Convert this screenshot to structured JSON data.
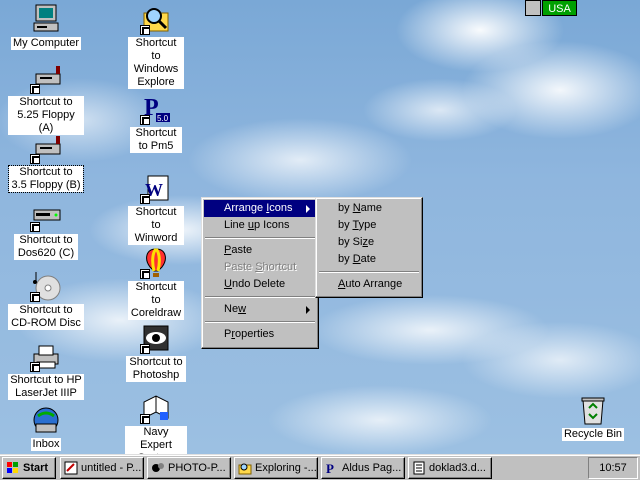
{
  "desktop": {
    "icons": [
      {
        "label": "My Computer"
      },
      {
        "label": "Shortcut to 5.25 Floppy (A)"
      },
      {
        "label": "Shortcut to 3.5 Floppy (B)"
      },
      {
        "label": "Shortcut to Dos620 (C)"
      },
      {
        "label": "Shortcut to CD-ROM Disc"
      },
      {
        "label": "Shortcut to HP LaserJet IIIP"
      },
      {
        "label": "Inbox"
      },
      {
        "label": "Shortcut to Windows Explore"
      },
      {
        "label": "Shortcut to Pm5"
      },
      {
        "label": "Shortcut to Winword"
      },
      {
        "label": "Shortcut to Coreldraw"
      },
      {
        "label": "Shortcut to Photoshp"
      },
      {
        "label": "Navy Expert System"
      },
      {
        "label": "Recycle Bin"
      }
    ]
  },
  "context_menu": {
    "items": [
      {
        "label": "Arrange Icons",
        "mnemonic": "I"
      },
      {
        "label": "Line up Icons",
        "mnemonic": "u"
      },
      {
        "label": "Paste",
        "mnemonic": "P"
      },
      {
        "label": "Paste Shortcut",
        "mnemonic": "S"
      },
      {
        "label": "Undo Delete",
        "mnemonic": "U"
      },
      {
        "label": "New",
        "mnemonic": "w"
      },
      {
        "label": "Properties",
        "mnemonic": "r"
      }
    ]
  },
  "submenu": {
    "items": [
      {
        "label": "by Name",
        "mnemonic": "N"
      },
      {
        "label": "by Type",
        "mnemonic": "T"
      },
      {
        "label": "by Size",
        "mnemonic": "z"
      },
      {
        "label": "by Date",
        "mnemonic": "D"
      },
      {
        "label": "Auto Arrange",
        "mnemonic": "A"
      }
    ]
  },
  "indicator": {
    "lang": "USA"
  },
  "taskbar": {
    "start": "Start",
    "buttons": [
      {
        "label": "untitled - P..."
      },
      {
        "label": "PHOTO-P..."
      },
      {
        "label": "Exploring -..."
      },
      {
        "label": "Aldus Pag..."
      },
      {
        "label": "doklad3.d..."
      }
    ],
    "clock": "10:57"
  },
  "colors": {
    "highlight": "#000080",
    "face": "#c0c0c0",
    "lang_bg": "#00a000"
  }
}
